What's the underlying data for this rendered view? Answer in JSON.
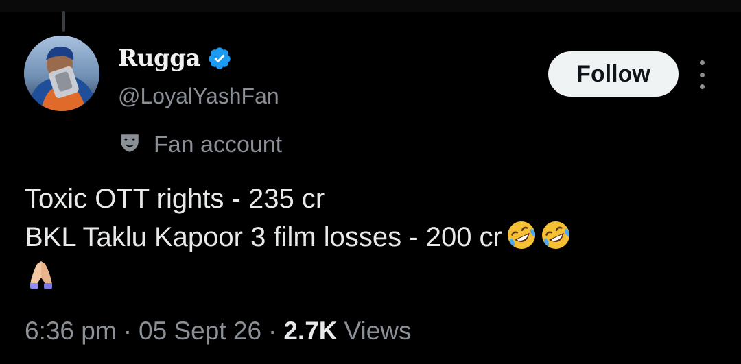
{
  "author": {
    "display_name": "Rugga",
    "handle": "@LoyalYashFan",
    "verified": true,
    "verified_color": "#1d9bf0",
    "avatar": "avatar-photo",
    "label_icon": "theater-mask-icon",
    "label": "Fan account"
  },
  "actions": {
    "follow_label": "Follow",
    "more_icon": "more-vertical-icon"
  },
  "tweet": {
    "lines": [
      "Toxic OTT rights - 235 cr",
      "BKL Taklu Kapoor 3 film losses - 200 cr"
    ],
    "emojis_line2": [
      "rolling-on-floor-laughing-emoji",
      "rolling-on-floor-laughing-emoji"
    ],
    "emojis_line3": [
      "folded-hands-emoji"
    ]
  },
  "meta": {
    "time": "6:36 pm",
    "date": "05 Sept 26",
    "views_count": "2.7K",
    "views_label": "Views",
    "separator": "·"
  },
  "colors": {
    "background": "#000000",
    "text_primary": "#e7e9ea",
    "text_secondary": "#8b9097",
    "follow_bg": "#eff3f4",
    "follow_text": "#0f1419"
  }
}
